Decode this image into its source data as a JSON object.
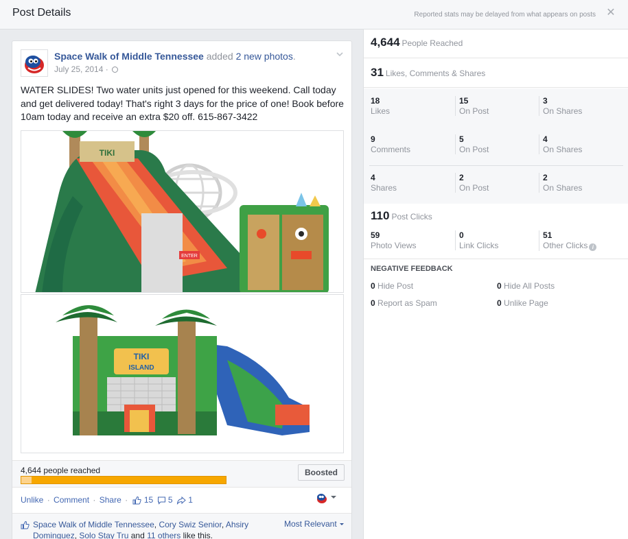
{
  "header": {
    "title": "Post Details",
    "note": "Reported stats may be delayed from what appears on posts",
    "close_icon": "close-icon"
  },
  "post": {
    "page_name": "Space Walk of Middle Tennessee",
    "action_text": " added ",
    "action_link": "2 new photos",
    "action_period": ".",
    "date": "July 25, 2014",
    "date_sep": " · ",
    "message": "WATER SLIDES! Two water units just opened for this weekend. Call today and get delivered today! That's right 3 days for the price of one! Book before 10am today and receive an extra $20 off. 615-867-3422",
    "photo1_sign": "TIKI",
    "photo1_tag": "ENTER",
    "photo2_sign_line1": "TIKI",
    "photo2_sign_line2": "ISLAND",
    "reach_text": "4,644 people reached",
    "organic_fraction": 0.05,
    "boosted_label": "Boosted",
    "actions": {
      "unlike": "Unlike",
      "comment": "Comment",
      "share": "Share",
      "sep": "·",
      "likes_count": "15",
      "comments_count": "5",
      "shares_count": "1"
    },
    "likers": {
      "l1": "Space Walk of Middle Tennessee",
      "l2": "Cory Swiz Senior",
      "l3": "Ahsiry Dominguez",
      "l4": "Solo Stay Tru",
      "and_text": " and ",
      "others": "11 others",
      "like_this": " like this.",
      "comma": ", "
    },
    "sort_label": "Most Relevant"
  },
  "stats": {
    "reached_num": "4,644",
    "reached_label": "People Reached",
    "engagement_num": "31",
    "engagement_label": "Likes, Comments & Shares",
    "likes": {
      "total": "18",
      "total_label": "Likes",
      "on_post": "15",
      "on_post_label": "On Post",
      "on_shares": "3",
      "on_shares_label": "On Shares"
    },
    "comments": {
      "total": "9",
      "total_label": "Comments",
      "on_post": "5",
      "on_post_label": "On Post",
      "on_shares": "4",
      "on_shares_label": "On Shares"
    },
    "shares": {
      "total": "4",
      "total_label": "Shares",
      "on_post": "2",
      "on_post_label": "On Post",
      "on_shares": "2",
      "on_shares_label": "On Shares"
    },
    "clicks_num": "110",
    "clicks_label": "Post Clicks",
    "photo_views": "59",
    "photo_views_label": "Photo Views",
    "link_clicks": "0",
    "link_clicks_label": "Link Clicks",
    "other_clicks": "51",
    "other_clicks_label": "Other Clicks",
    "info_glyph": "i",
    "negative_title": "NEGATIVE FEEDBACK",
    "hide_post_num": "0",
    "hide_post_label": "Hide Post",
    "hide_all_num": "0",
    "hide_all_label": "Hide All Posts",
    "spam_num": "0",
    "spam_label": "Report as Spam",
    "unlike_page_num": "0",
    "unlike_page_label": "Unlike Page"
  },
  "colors": {
    "link": "#365899",
    "boost_bar": "#f7a700",
    "organic_bar": "#fdd38c"
  }
}
